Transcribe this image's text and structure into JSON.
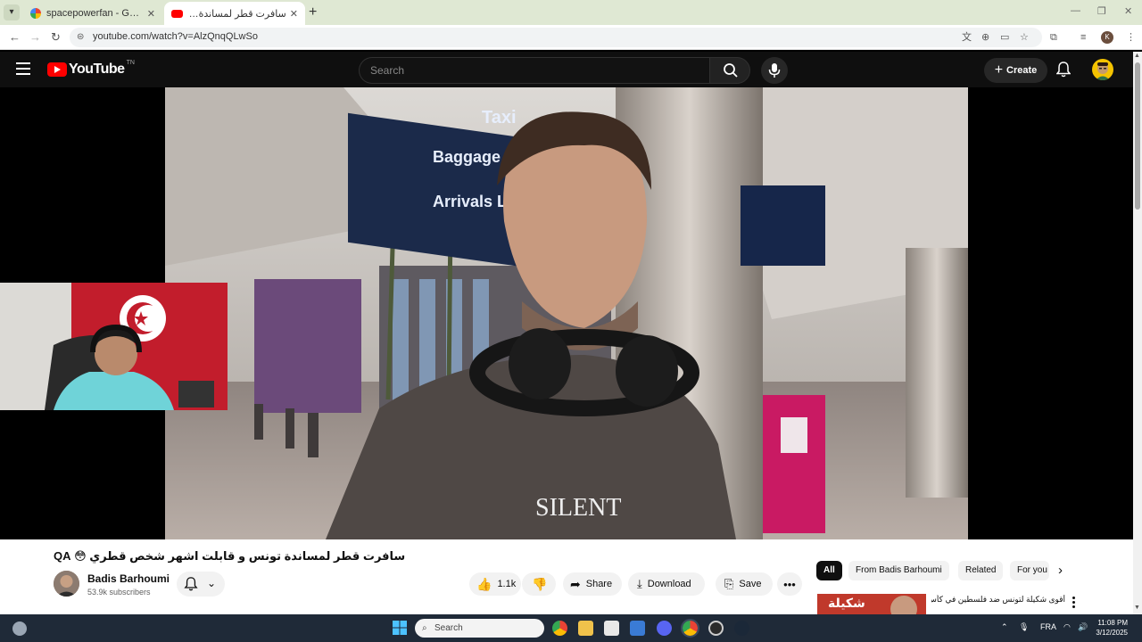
{
  "browser": {
    "tabs": [
      {
        "label": "spacepowerfan - Google Search",
        "favicon": "google-icon",
        "active": false
      },
      {
        "label": "سافرت قطر لمساندة تونس و قابلت اشهر شخص قطري",
        "favicon": "youtube-icon",
        "active": true
      }
    ],
    "new_tab_label": "+",
    "address": "youtube.com/watch?v=AlzQnqQLwSo"
  },
  "youtube": {
    "logo_text": "YouTube",
    "country_code": "TN",
    "search_placeholder": "Search",
    "create_label": "Create"
  },
  "video": {
    "title": "سافرت قطر لمساندة تونس و قابلت اشهر شخص قطري 😳 QA",
    "channel": {
      "name": "Badis Barhoumi",
      "subscribers": "53.9k subscribers"
    },
    "actions": {
      "likes": "1.1k",
      "share": "Share",
      "download": "Download",
      "save": "Save"
    }
  },
  "recommendations": {
    "chips": [
      "All",
      "From Badis Barhoumi",
      "Related",
      "For you"
    ],
    "first_item_title": "أقوى شكيلة لتونس ضد فلسطين في كأس العرب",
    "first_item_thumb_text": "شكيلة"
  },
  "taskbar": {
    "search_label": "Search",
    "language": "FRA",
    "time": "11:08 PM",
    "date": "3/12/2025"
  },
  "colors": {
    "youtube_red": "#ff0000",
    "header_bg": "#0f0f0f",
    "taskbar_bg": "#1f2a38",
    "tabstrip_bg": "#dfe8d3"
  }
}
